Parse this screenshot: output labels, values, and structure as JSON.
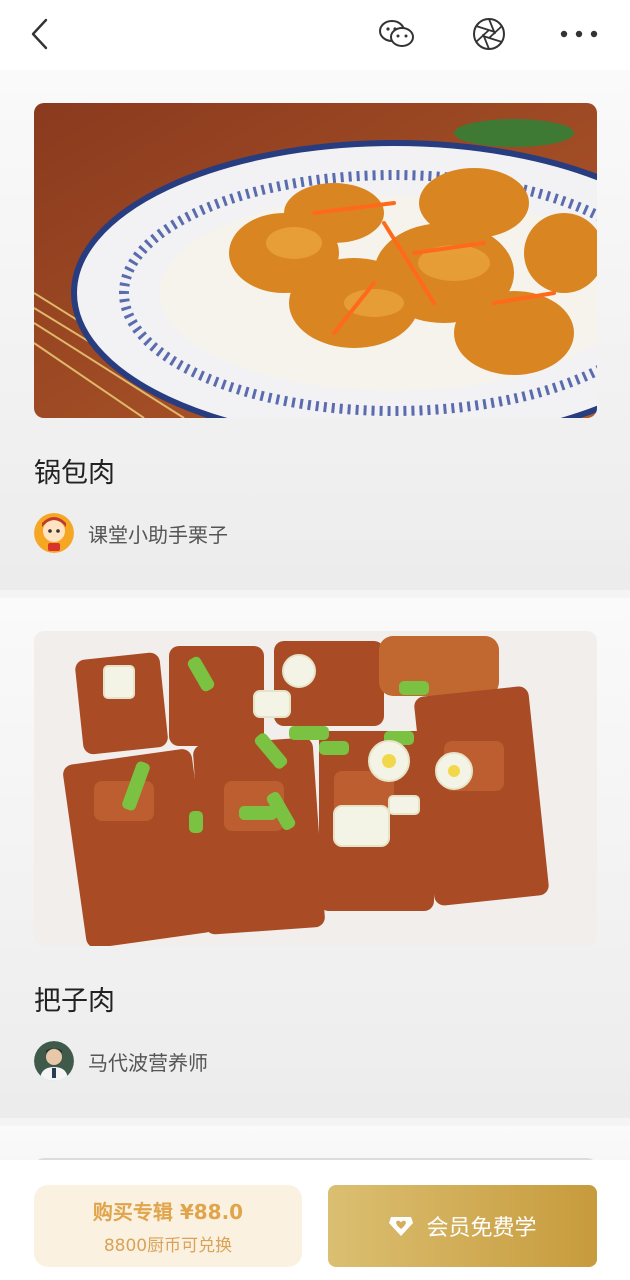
{
  "header": {
    "back_icon": "chevron-left-icon",
    "wechat_icon": "wechat-icon",
    "moments_icon": "aperture-icon",
    "more_icon": "more-horizontal-icon"
  },
  "items": [
    {
      "title": "锅包肉",
      "author": "课堂小助手栗子"
    },
    {
      "title": "把子肉",
      "author": "马代波营养师"
    }
  ],
  "footer": {
    "buy_label": "购买专辑 ¥88.0",
    "coins_label": "8800厨币可兑换",
    "vip_label": "会员免费学",
    "vip_icon": "diamond-heart-icon",
    "colors": {
      "buy_text": "#e0a54c",
      "vip_start": "#dbbf72",
      "vip_end": "#c79b3c"
    }
  }
}
